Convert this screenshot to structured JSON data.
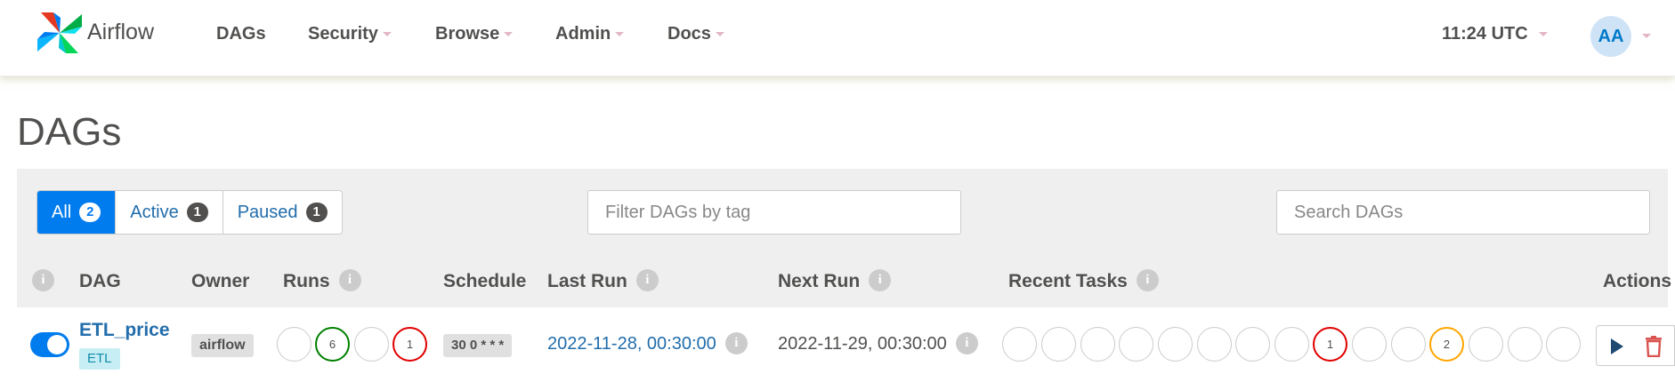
{
  "brand": {
    "name": "Airflow"
  },
  "nav": {
    "items": [
      {
        "label": "DAGs"
      },
      {
        "label": "Security"
      },
      {
        "label": "Browse"
      },
      {
        "label": "Admin"
      },
      {
        "label": "Docs"
      }
    ],
    "clock": "11:24 UTC",
    "avatar_initials": "AA"
  },
  "page": {
    "title": "DAGs"
  },
  "filters": {
    "all": {
      "label": "All",
      "count": "2"
    },
    "active": {
      "label": "Active",
      "count": "1"
    },
    "paused": {
      "label": "Paused",
      "count": "1"
    }
  },
  "tag_filter": {
    "placeholder": "Filter DAGs by tag"
  },
  "search": {
    "placeholder": "Search DAGs"
  },
  "table": {
    "headers": {
      "dag": "DAG",
      "owner": "Owner",
      "runs": "Runs",
      "schedule": "Schedule",
      "last_run": "Last Run",
      "next_run": "Next Run",
      "recent_tasks": "Recent Tasks",
      "actions": "Actions"
    },
    "info_glyph": "i",
    "rows": [
      {
        "toggle_on": true,
        "dag_id": "ETL_price",
        "tag": "ETL",
        "owner": "airflow",
        "runs": [
          "",
          "6",
          "",
          "1"
        ],
        "schedule": "30 0 * * *",
        "last_run": "2022-11-28, 00:30:00",
        "next_run": "2022-11-29, 00:30:00",
        "recent_tasks": [
          "",
          "",
          "",
          "",
          "",
          "",
          "",
          "",
          "1",
          "",
          "",
          "2",
          "",
          "",
          ""
        ]
      }
    ]
  },
  "colors": {
    "primary": "#017cee",
    "link": "#226dab",
    "success": "#008000",
    "failed": "#e00000",
    "upstream_failed": "#ffa500",
    "delete": "#d9534f"
  },
  "icons": {
    "trigger": "play-icon",
    "delete": "trash-icon",
    "info": "info-icon"
  }
}
